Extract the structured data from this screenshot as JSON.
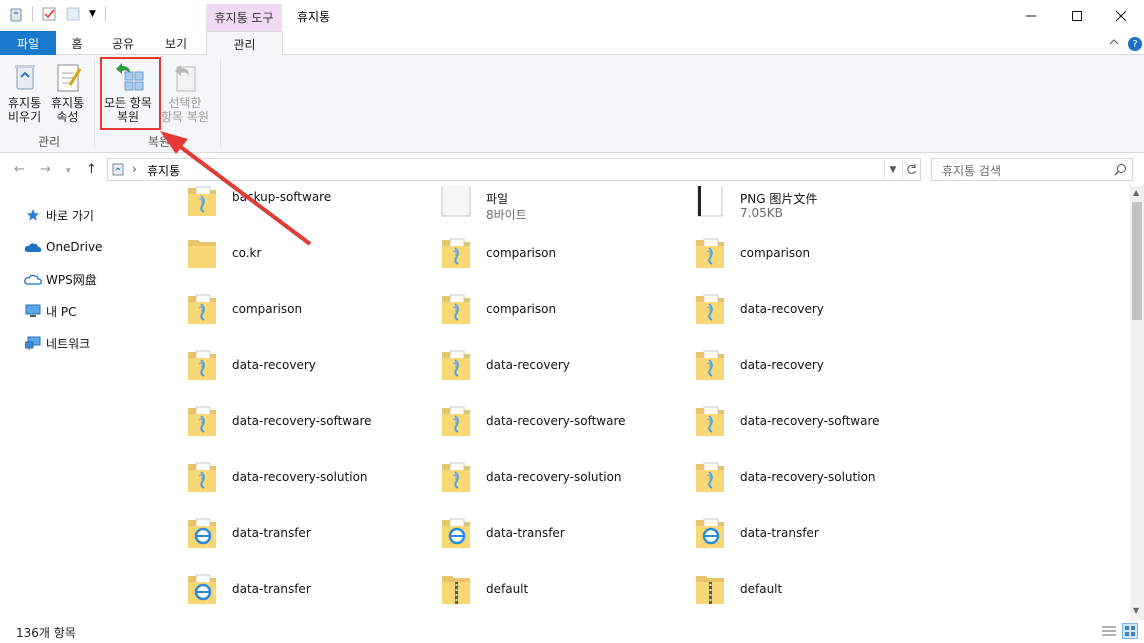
{
  "window": {
    "title": "휴지통",
    "context_tab": "휴지통 도구",
    "controls": {
      "minimize": "—",
      "maximize": "☐",
      "close": "✕"
    }
  },
  "tabs": [
    {
      "label": "파일"
    },
    {
      "label": "홈"
    },
    {
      "label": "공유"
    },
    {
      "label": "보기"
    },
    {
      "label": "관리"
    }
  ],
  "ribbon": {
    "empty_bin": {
      "line1": "휴지통",
      "line2": "비우기"
    },
    "bin_props": {
      "line1": "휴지통",
      "line2": "속성"
    },
    "group_manage": "관리",
    "restore_all": {
      "line1": "모든 항목",
      "line2": "복원"
    },
    "restore_selected": {
      "line1": "선택한",
      "line2": "항목 복원"
    },
    "group_restore": "복원"
  },
  "address": {
    "path": "휴지통",
    "search_placeholder": "휴지통 검색"
  },
  "sidebar": {
    "items": [
      {
        "label": "바로 가기",
        "icon": "star-icon"
      },
      {
        "label": "OneDrive",
        "icon": "cloud-icon"
      },
      {
        "label": "WPS网盘",
        "icon": "cloud-outline-icon"
      },
      {
        "label": "내 PC",
        "icon": "computer-icon"
      },
      {
        "label": "네트워크",
        "icon": "network-icon"
      }
    ]
  },
  "files": [
    {
      "name": "backup-software",
      "icon": "folder-zip-icon"
    },
    {
      "name": "파일",
      "sub": "8바이트",
      "icon": "blank-file-icon"
    },
    {
      "name": "PNG 图片文件",
      "sub": "7.05KB",
      "icon": "image-file-icon"
    },
    {
      "name": "co.kr",
      "icon": "folder-icon"
    },
    {
      "name": "comparison",
      "icon": "folder-zip-icon"
    },
    {
      "name": "comparison",
      "icon": "folder-zip-icon"
    },
    {
      "name": "comparison",
      "icon": "folder-zip-icon"
    },
    {
      "name": "comparison",
      "icon": "folder-zip-icon"
    },
    {
      "name": "data-recovery",
      "icon": "folder-zip-icon"
    },
    {
      "name": "data-recovery",
      "icon": "folder-zip-icon"
    },
    {
      "name": "data-recovery",
      "icon": "folder-zip-icon"
    },
    {
      "name": "data-recovery",
      "icon": "folder-zip-icon"
    },
    {
      "name": "data-recovery-software",
      "icon": "folder-zip-icon"
    },
    {
      "name": "data-recovery-software",
      "icon": "folder-zip-icon"
    },
    {
      "name": "data-recovery-software",
      "icon": "folder-zip-icon"
    },
    {
      "name": "data-recovery-solution",
      "icon": "folder-zip-icon"
    },
    {
      "name": "data-recovery-solution",
      "icon": "folder-zip-icon"
    },
    {
      "name": "data-recovery-solution",
      "icon": "folder-zip-icon"
    },
    {
      "name": "data-transfer",
      "icon": "folder-ie-icon"
    },
    {
      "name": "data-transfer",
      "icon": "folder-ie-icon"
    },
    {
      "name": "data-transfer",
      "icon": "folder-ie-icon"
    },
    {
      "name": "data-transfer",
      "icon": "folder-ie-icon"
    },
    {
      "name": "default",
      "icon": "folder-zipper-icon"
    },
    {
      "name": "default",
      "icon": "folder-zipper-icon"
    }
  ],
  "status": {
    "count": "136개 항목"
  },
  "colors": {
    "accent": "#1979ca",
    "highlight": "#e53935",
    "context_tab": "#f1d8f3"
  }
}
